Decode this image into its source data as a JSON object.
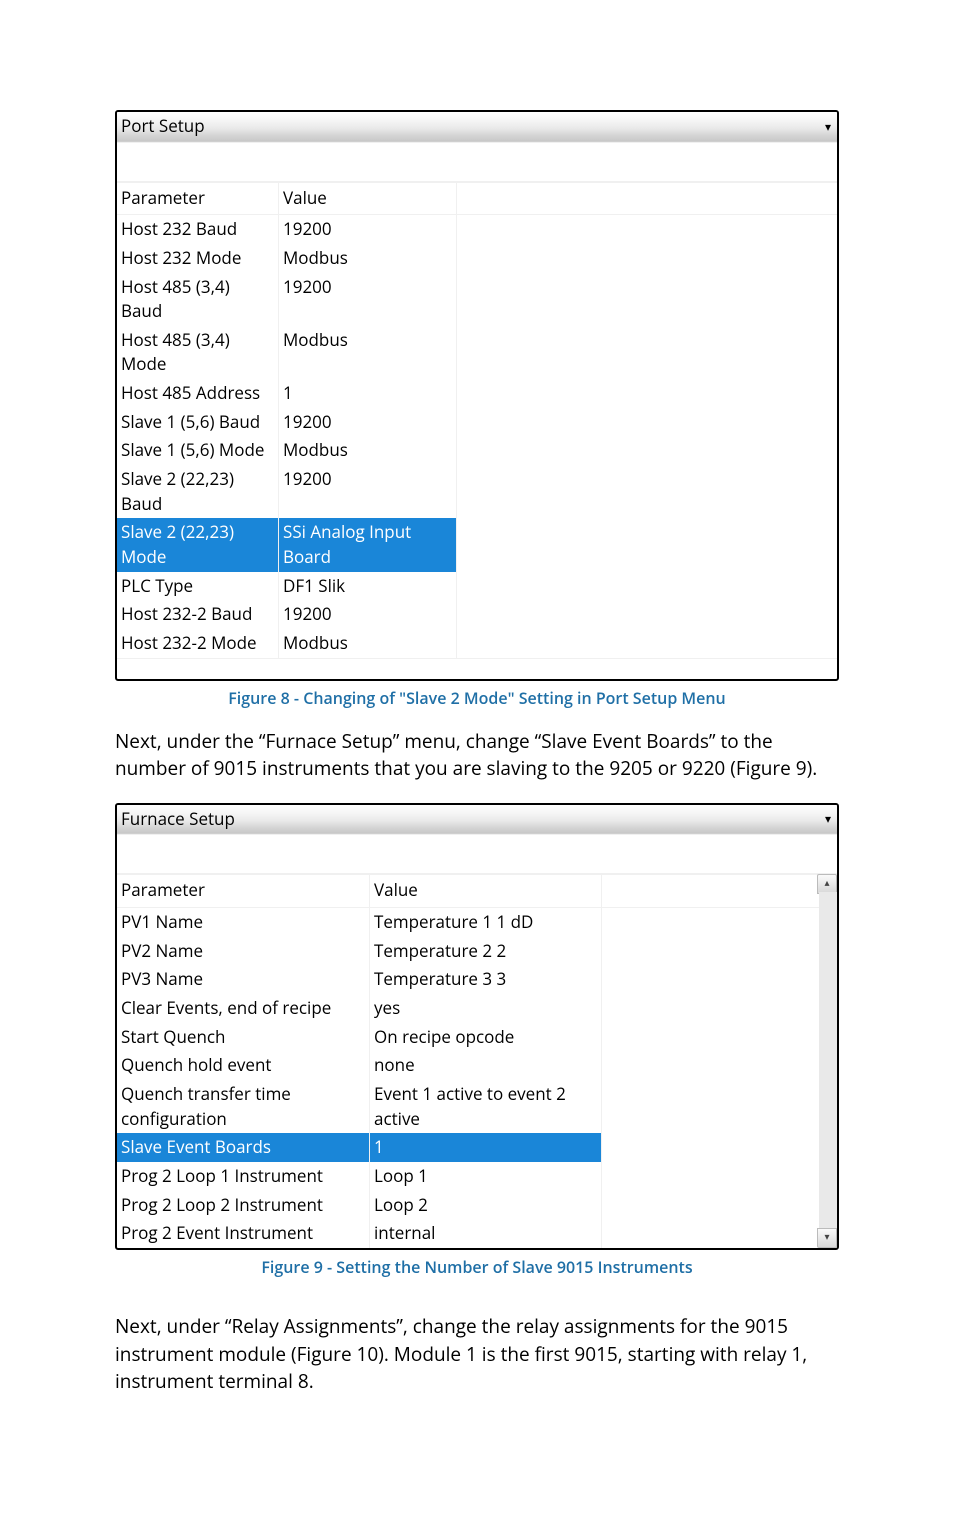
{
  "port_panel": {
    "title": "Port Setup",
    "headers": {
      "param": "Parameter",
      "value": "Value"
    },
    "rows": [
      {
        "param": "Host 232 Baud",
        "value": "19200",
        "selected": false
      },
      {
        "param": "Host 232 Mode",
        "value": "Modbus",
        "selected": false
      },
      {
        "param": "Host 485 (3,4) Baud",
        "value": "19200",
        "selected": false
      },
      {
        "param": "Host 485 (3,4) Mode",
        "value": "Modbus",
        "selected": false
      },
      {
        "param": "Host 485 Address",
        "value": "1",
        "selected": false
      },
      {
        "param": "Slave 1 (5,6) Baud",
        "value": "19200",
        "selected": false
      },
      {
        "param": "Slave 1 (5,6) Mode",
        "value": "Modbus",
        "selected": false
      },
      {
        "param": "Slave 2 (22,23) Baud",
        "value": "19200",
        "selected": false
      },
      {
        "param": "Slave 2 (22,23) Mode",
        "value": "SSi Analog Input Board",
        "selected": true
      },
      {
        "param": "PLC Type",
        "value": "DF1 Slik",
        "selected": false
      },
      {
        "param": "Host 232-2 Baud",
        "value": "19200",
        "selected": false
      },
      {
        "param": "Host 232-2 Mode",
        "value": "Modbus",
        "selected": false
      }
    ]
  },
  "caption_8": "Figure 8 - Changing of \"Slave 2 Mode\" Setting in Port Setup Menu",
  "para_1": "Next, under the “Furnace Setup” menu, change “Slave Event Boards” to the number of 9015 instruments that you are slaving to the 9205 or 9220 (Figure 9).",
  "furnace_panel": {
    "title": "Furnace Setup",
    "headers": {
      "param": "Parameter",
      "value": "Value"
    },
    "rows": [
      {
        "param": "PV1 Name",
        "value": "Temperature 1 1  dD",
        "selected": false
      },
      {
        "param": "PV2 Name",
        "value": "Temperature 2 2",
        "selected": false
      },
      {
        "param": "PV3 Name",
        "value": "Temperature 3 3",
        "selected": false
      },
      {
        "param": "Clear Events, end of recipe",
        "value": "yes",
        "selected": false
      },
      {
        "param": "Start Quench",
        "value": "On recipe opcode",
        "selected": false
      },
      {
        "param": "Quench hold event",
        "value": "none",
        "selected": false
      },
      {
        "param": "Quench transfer time configuration",
        "value": "Event 1 active to event 2 active",
        "selected": false
      },
      {
        "param": "Slave Event Boards",
        "value": "1",
        "selected": true
      },
      {
        "param": "Prog 2 Loop 1 Instrument",
        "value": "Loop 1",
        "selected": false
      },
      {
        "param": "Prog 2 Loop 2 Instrument",
        "value": "Loop 2",
        "selected": false
      },
      {
        "param": "Prog 2 Event Instrument",
        "value": "internal",
        "selected": false
      }
    ]
  },
  "caption_9": "Figure 9 - Setting the Number of Slave 9015 Instruments",
  "para_2": "Next, under “Relay Assignments”, change the relay assignments for the 9015 instrument module (Figure 10). Module 1 is the first 9015, starting with relay 1, instrument terminal 8."
}
